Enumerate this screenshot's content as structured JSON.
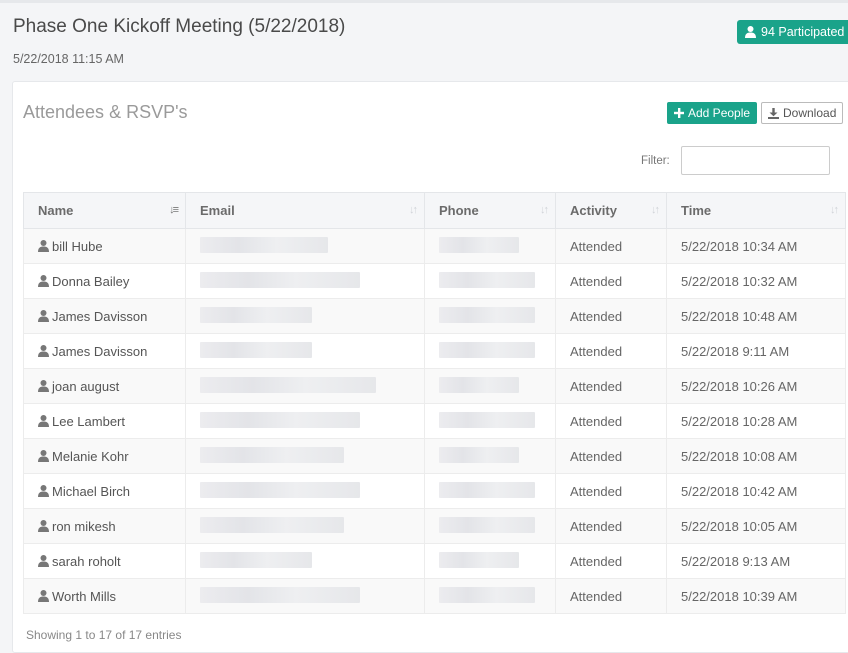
{
  "meeting": {
    "title": "Phase One Kickoff Meeting (5/22/2018)",
    "datetime": "5/22/2018 11:15 AM",
    "participated_label": "94 Participated"
  },
  "card": {
    "title": "Attendees & RSVP's",
    "add_people_label": "Add People",
    "download_label": "Download",
    "filter_label": "Filter:",
    "filter_value": ""
  },
  "table": {
    "columns": [
      "Name",
      "Email",
      "Phone",
      "Activity",
      "Time"
    ],
    "rows": [
      {
        "name": "bill Hube",
        "activity": "Attended",
        "time": "5/22/2018 10:34 AM"
      },
      {
        "name": "Donna Bailey",
        "activity": "Attended",
        "time": "5/22/2018 10:32 AM"
      },
      {
        "name": "James Davisson",
        "activity": "Attended",
        "time": "5/22/2018 10:48 AM"
      },
      {
        "name": "James Davisson",
        "activity": "Attended",
        "time": "5/22/2018 9:11 AM"
      },
      {
        "name": "joan august",
        "activity": "Attended",
        "time": "5/22/2018 10:26 AM"
      },
      {
        "name": "Lee Lambert",
        "activity": "Attended",
        "time": "5/22/2018 10:28 AM"
      },
      {
        "name": "Melanie Kohr",
        "activity": "Attended",
        "time": "5/22/2018 10:08 AM"
      },
      {
        "name": "Michael Birch",
        "activity": "Attended",
        "time": "5/22/2018 10:42 AM"
      },
      {
        "name": "ron mikesh",
        "activity": "Attended",
        "time": "5/22/2018 10:05 AM"
      },
      {
        "name": "sarah roholt",
        "activity": "Attended",
        "time": "5/22/2018 9:13 AM"
      },
      {
        "name": "Worth Mills",
        "activity": "Attended",
        "time": "5/22/2018 10:39 AM"
      }
    ]
  },
  "footer": {
    "info": "Showing 1 to 17 of 17 entries"
  },
  "icons": {
    "user": "user-icon",
    "plus": "plus-icon",
    "download": "download-icon",
    "sort": "sort-icon"
  },
  "colors": {
    "accent": "#1aa38a"
  }
}
